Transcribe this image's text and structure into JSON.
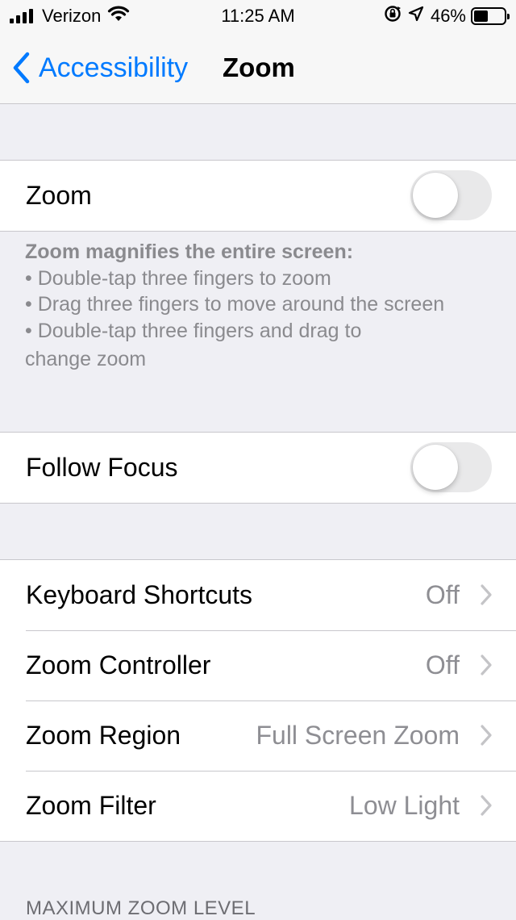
{
  "status_bar": {
    "carrier": "Verizon",
    "time": "11:25 AM",
    "battery": "46%",
    "battery_level": 0.46,
    "icons": [
      "signal-icon",
      "wifi-icon",
      "orientation-lock-icon",
      "location-icon",
      "battery-icon"
    ]
  },
  "nav": {
    "back_label": "Accessibility",
    "title": "Zoom"
  },
  "zoom_toggle": {
    "label": "Zoom",
    "on": false
  },
  "zoom_description": {
    "heading": "Zoom magnifies the entire screen:",
    "bullets": [
      "•  Double-tap three fingers to zoom",
      "•  Drag three fingers to move around the screen",
      "•  Double-tap three fingers and drag to"
    ],
    "continuation": "change zoom"
  },
  "follow_focus": {
    "label": "Follow Focus",
    "on": false
  },
  "settings_rows": [
    {
      "label": "Keyboard Shortcuts",
      "value": "Off"
    },
    {
      "label": "Zoom Controller",
      "value": "Off"
    },
    {
      "label": "Zoom Region",
      "value": "Full Screen Zoom"
    },
    {
      "label": "Zoom Filter",
      "value": "Low Light"
    }
  ],
  "max_zoom_header": "MAXIMUM ZOOM LEVEL",
  "colors": {
    "accent": "#007aff",
    "background": "#efeff4",
    "secondary_text": "#8e8e93",
    "toggle_off": "#e9e9ea"
  }
}
